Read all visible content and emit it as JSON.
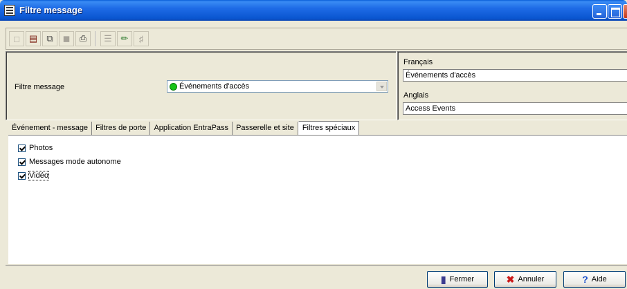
{
  "window": {
    "title": "Filtre message"
  },
  "filter": {
    "label": "Filtre message",
    "value": "Événements d'accès"
  },
  "languages": {
    "french_label": "Français",
    "french_value": "Événements d'accès",
    "english_label": "Anglais",
    "english_value": "Access Events"
  },
  "tabs": [
    {
      "label": "Événement - message"
    },
    {
      "label": "Filtres de porte"
    },
    {
      "label": "Application EntraPass"
    },
    {
      "label": "Passerelle et site"
    },
    {
      "label": "Filtres spéciaux"
    }
  ],
  "checkboxes": [
    {
      "label": "Photos",
      "checked": true
    },
    {
      "label": "Messages mode autonome",
      "checked": true
    },
    {
      "label": "Vidéo",
      "checked": true
    }
  ],
  "buttons": {
    "close": "Fermer",
    "cancel": "Annuler",
    "help": "Aide"
  }
}
